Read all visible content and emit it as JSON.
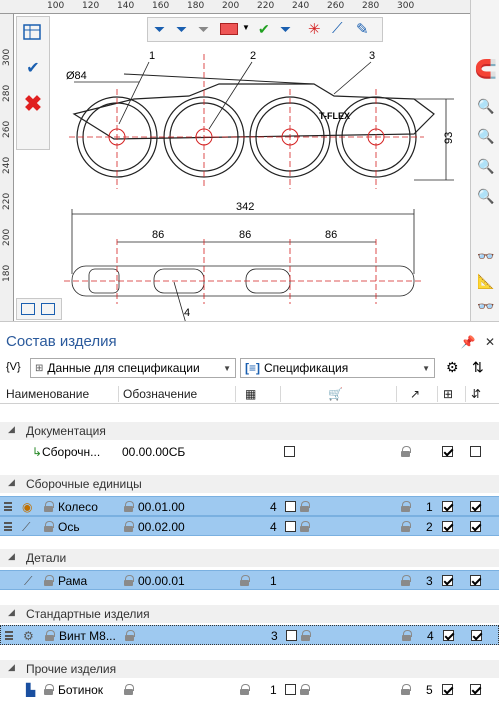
{
  "drawing": {
    "ruler_top_ticks": [
      "100",
      "120",
      "140",
      "160",
      "180",
      "200",
      "220",
      "240",
      "260",
      "280",
      "300"
    ],
    "ruler_left_ticks": [
      "300",
      "280",
      "260",
      "240",
      "220",
      "200",
      "180"
    ],
    "callouts": [
      "1",
      "2",
      "3",
      "4"
    ],
    "dim_diameter": "Ø84",
    "dim_height": "93",
    "dim_overall": "342",
    "dim_spacing": [
      "86",
      "86",
      "86"
    ],
    "brand": "T-FLEX"
  },
  "panel": {
    "title": "Состав изделия",
    "filter_label": "{V}",
    "source_select": "Данные для спецификации",
    "doc_select": "Спецификация",
    "columns": {
      "name": "Наименование",
      "designation": "Обозначение"
    },
    "groups": [
      {
        "title": "Документация"
      },
      {
        "title": "Сборочные единицы"
      },
      {
        "title": "Детали"
      },
      {
        "title": "Стандартные изделия"
      },
      {
        "title": "Прочие изделия"
      }
    ],
    "rows": [
      {
        "name": "Сборочн...",
        "designation": "00.00.00СБ",
        "qty": "",
        "pos": ""
      },
      {
        "name": "Колесо",
        "designation": "00.01.00",
        "qty": "4",
        "pos": "1"
      },
      {
        "name": "Ось",
        "designation": "00.02.00",
        "qty": "4",
        "pos": "2"
      },
      {
        "name": "Рама",
        "designation": "00.00.01",
        "qty": "1",
        "pos": "3"
      },
      {
        "name": "Винт M8...",
        "designation": "",
        "qty": "3",
        "pos": "4"
      },
      {
        "name": "Ботинок",
        "designation": "",
        "qty": "1",
        "pos": "5"
      }
    ]
  },
  "icons": {
    "accept": "check-icon",
    "cancel": "cross-icon",
    "magnet": "magnet-icon",
    "zoom": "zoom-icon"
  },
  "colors": {
    "selected_row": "#9ec9f0",
    "title": "#2b5a9c",
    "centerline": "#d42020"
  }
}
